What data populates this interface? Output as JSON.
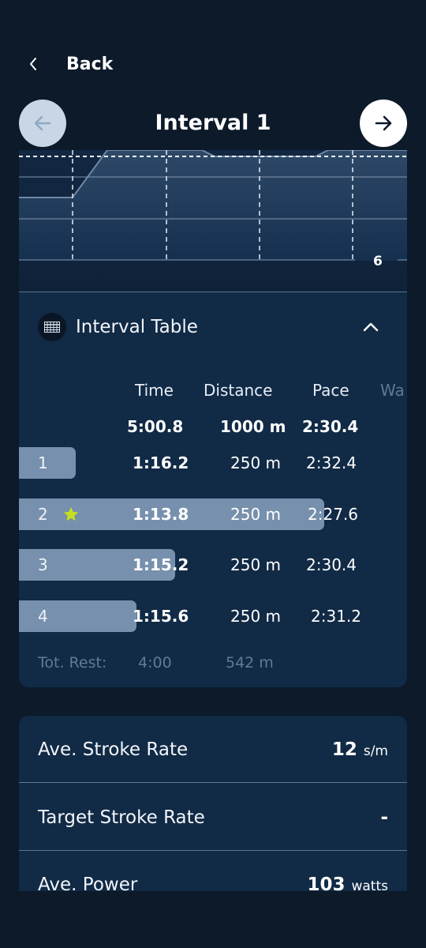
{
  "header": {
    "back_label": "Back",
    "title": "Interval 1"
  },
  "chart": {
    "right_label": "6"
  },
  "interval_table": {
    "title": "Interval Table",
    "columns": {
      "time": "Time",
      "distance": "Distance",
      "pace": "Pace",
      "watts": "Wa"
    },
    "totals": {
      "time": "5:00.8",
      "distance": "1000 m",
      "pace": "2:30.4"
    },
    "rows": [
      {
        "num": "1",
        "time": "1:16.2",
        "distance": "250 m",
        "pace": "2:32.4",
        "starred": false,
        "bar_fraction": 0.16
      },
      {
        "num": "2",
        "time": "1:13.8",
        "distance": "250 m",
        "pace": "2:27.6",
        "starred": true,
        "bar_fraction": 0.86
      },
      {
        "num": "3",
        "time": "1:15.2",
        "distance": "250 m",
        "pace": "2:30.4",
        "starred": false,
        "bar_fraction": 0.44
      },
      {
        "num": "4",
        "time": "1:15.6",
        "distance": "250 m",
        "pace": "2:31.2",
        "starred": false,
        "bar_fraction": 0.33
      }
    ],
    "rest": {
      "label": "Tot. Rest:",
      "time": "4:00",
      "distance": "542 m"
    }
  },
  "stats": [
    {
      "label": "Ave. Stroke Rate",
      "value": "12",
      "unit": "s/m"
    },
    {
      "label": "Target Stroke Rate",
      "value": "-",
      "unit": ""
    },
    {
      "label": "Ave. Power",
      "value": "103",
      "unit": "watts"
    }
  ],
  "colors": {
    "background": "#0c1a2a",
    "card": "#112a46",
    "bar": "#7790ad",
    "star": "#c6de1f"
  }
}
